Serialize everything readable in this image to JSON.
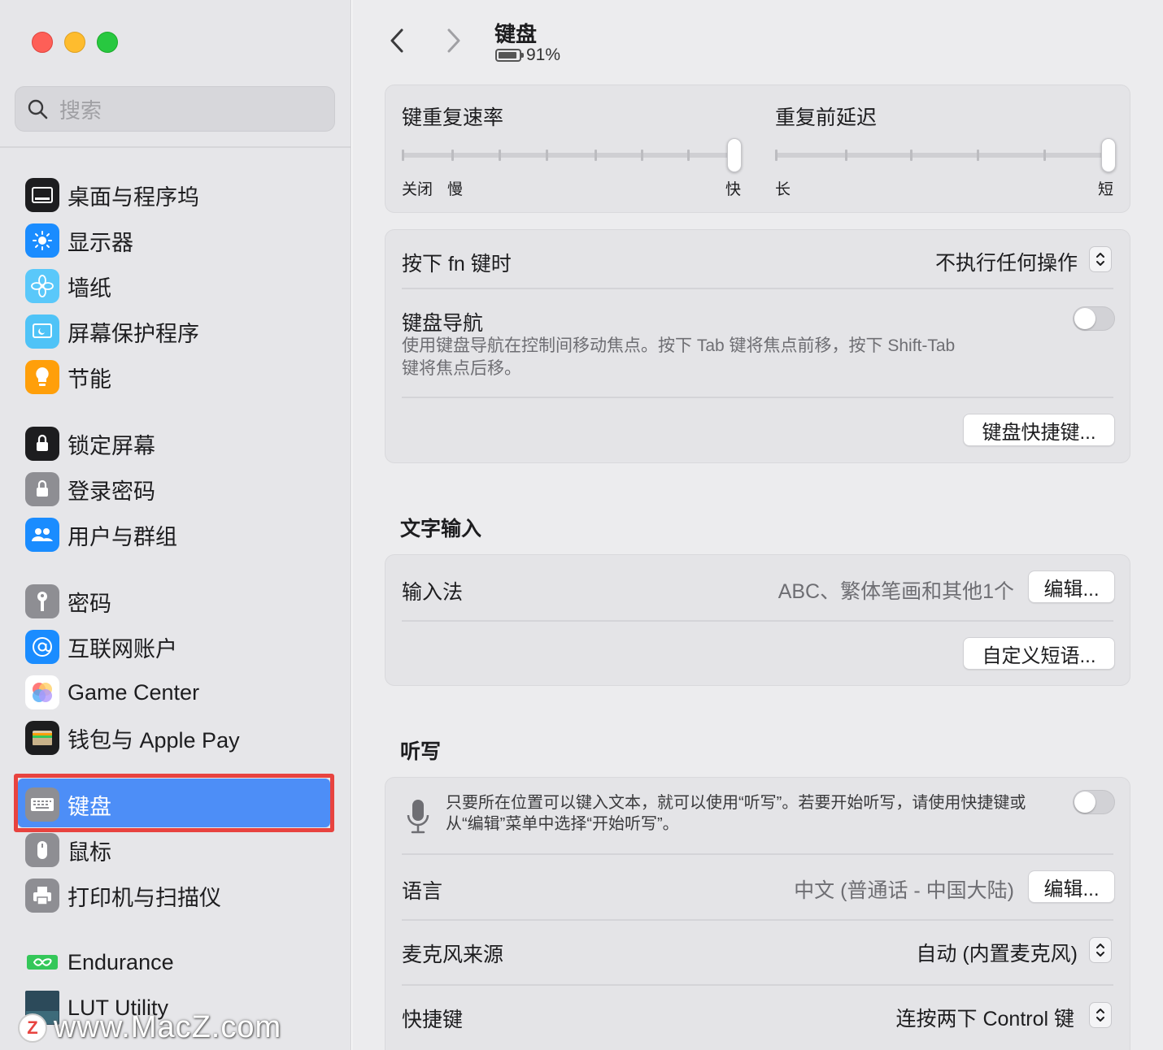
{
  "sidebar": {
    "search_placeholder": "搜索",
    "items": [
      {
        "label": "桌面与程序坞",
        "icon": "dock-icon",
        "color": "#1d1d1f"
      },
      {
        "label": "显示器",
        "icon": "display-brightness-icon",
        "color": "#1a8cff"
      },
      {
        "label": "墙纸",
        "icon": "wallpaper-flower-icon",
        "color": "#5ac8fa"
      },
      {
        "label": "屏幕保护程序",
        "icon": "screensaver-icon",
        "color": "#4fc3f7"
      },
      {
        "label": "节能",
        "icon": "energy-bulb-icon",
        "color": "#ff9f0a"
      },
      {
        "label": "锁定屏幕",
        "icon": "lock-screen-icon",
        "color": "#1d1d1f"
      },
      {
        "label": "登录密码",
        "icon": "login-lock-icon",
        "color": "#8e8e93"
      },
      {
        "label": "用户与群组",
        "icon": "users-groups-icon",
        "color": "#1a8cff"
      },
      {
        "label": "密码",
        "icon": "key-icon",
        "color": "#8e8e93"
      },
      {
        "label": "互联网账户",
        "icon": "at-sign-icon",
        "color": "#1a8cff"
      },
      {
        "label": "Game Center",
        "icon": "game-center-icon",
        "color": "#ffffff"
      },
      {
        "label": "钱包与 Apple Pay",
        "icon": "wallet-icon",
        "color": "#1d1d1f"
      },
      {
        "label": "键盘",
        "icon": "keyboard-icon",
        "color": "#8e8e93"
      },
      {
        "label": "鼠标",
        "icon": "mouse-icon",
        "color": "#8e8e93"
      },
      {
        "label": "打印机与扫描仪",
        "icon": "printer-icon",
        "color": "#8e8e93"
      },
      {
        "label": "Endurance",
        "icon": "endurance-icon",
        "color": "#34c759"
      },
      {
        "label": "LUT Utility",
        "icon": "lut-utility-icon",
        "color": "#2c4a5a"
      }
    ],
    "selected_index": 12,
    "watermark": "www.MacZ.com",
    "watermark_logo": "Z"
  },
  "header": {
    "title": "键盘",
    "battery": "91%"
  },
  "repeat": {
    "rate_title": "键重复速率",
    "rate_labels": [
      "关闭",
      "慢",
      "快"
    ],
    "rate_value": 1.0,
    "delay_title": "重复前延迟",
    "delay_labels": [
      "长",
      "短"
    ],
    "delay_value": 1.0
  },
  "fn_card": {
    "fn_label": "按下 fn 键时",
    "fn_value": "不执行任何操作",
    "nav_label": "键盘导航",
    "nav_desc_line1": "使用键盘导航在控制间移动焦点。按下 Tab 键将焦点前移，按下 Shift-Tab",
    "nav_desc_line2": "键将焦点后移。",
    "nav_enabled": false,
    "shortcuts_button": "键盘快捷键..."
  },
  "text_input": {
    "section_title": "文字输入",
    "input_label": "输入法",
    "input_value": "ABC、繁体笔画和其他1个",
    "edit_button": "编辑...",
    "replacement_button": "自定义短语..."
  },
  "dictation": {
    "section_title": "听写",
    "desc_line1": "只要所在位置可以键入文本，就可以使用“听写”。若要开始听写，请使用快捷键或",
    "desc_line2": "从“编辑”菜单中选择“开始听写”。",
    "enabled": false,
    "language_label": "语言",
    "language_value": "中文 (普通话 - 中国大陆)",
    "language_edit_button": "编辑...",
    "mic_label": "麦克风来源",
    "mic_value": "自动 (内置麦克风)",
    "shortcut_label": "快捷键",
    "shortcut_value": "连按两下 Control 键"
  }
}
